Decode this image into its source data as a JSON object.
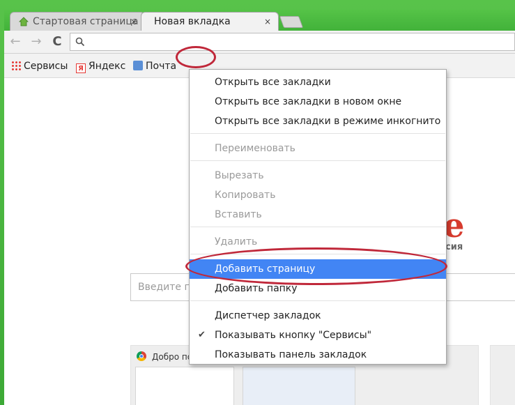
{
  "tabs": [
    {
      "title": "Стартовая страница",
      "close": "×"
    },
    {
      "title": "Новая вкладка",
      "close": "×"
    }
  ],
  "toolbar": {
    "back": "←",
    "forward": "→",
    "reload": "C",
    "search_icon": "search-icon"
  },
  "bookmarks": [
    {
      "label": "Сервисы",
      "icon": "apps-grid-icon"
    },
    {
      "label": "Яндекс",
      "icon": "yandex-icon",
      "glyph": "Я"
    },
    {
      "label": "Почта",
      "icon": "mail-icon"
    }
  ],
  "page": {
    "logo_fragment": "e",
    "logo_subtitle": "сия",
    "search_placeholder": "Введите п",
    "thumb_title": "Добро по"
  },
  "menu": {
    "items": [
      {
        "label": "Открыть все закладки",
        "enabled": true
      },
      {
        "label": "Открыть все закладки в новом окне",
        "enabled": true
      },
      {
        "label": "Открыть все закладки в режиме инкогнито",
        "enabled": true
      },
      {
        "label": "Переименовать",
        "enabled": false
      },
      {
        "label": "Вырезать",
        "enabled": false
      },
      {
        "label": "Копировать",
        "enabled": false
      },
      {
        "label": "Вставить",
        "enabled": false
      },
      {
        "label": "Удалить",
        "enabled": false
      },
      {
        "label": "Добавить страницу",
        "enabled": true,
        "selected": true
      },
      {
        "label": "Добавить папку",
        "enabled": true
      },
      {
        "label": "Диспетчер закладок",
        "enabled": true
      },
      {
        "label": "Показывать кнопку \"Сервисы\"",
        "enabled": true,
        "checked": true,
        "check_glyph": "✔"
      },
      {
        "label": "Показывать панель закладок",
        "enabled": true
      }
    ]
  },
  "colors": {
    "highlight": "#4285f4",
    "annotation_red": "#c0283a",
    "desktop_green": "#42b23a"
  }
}
